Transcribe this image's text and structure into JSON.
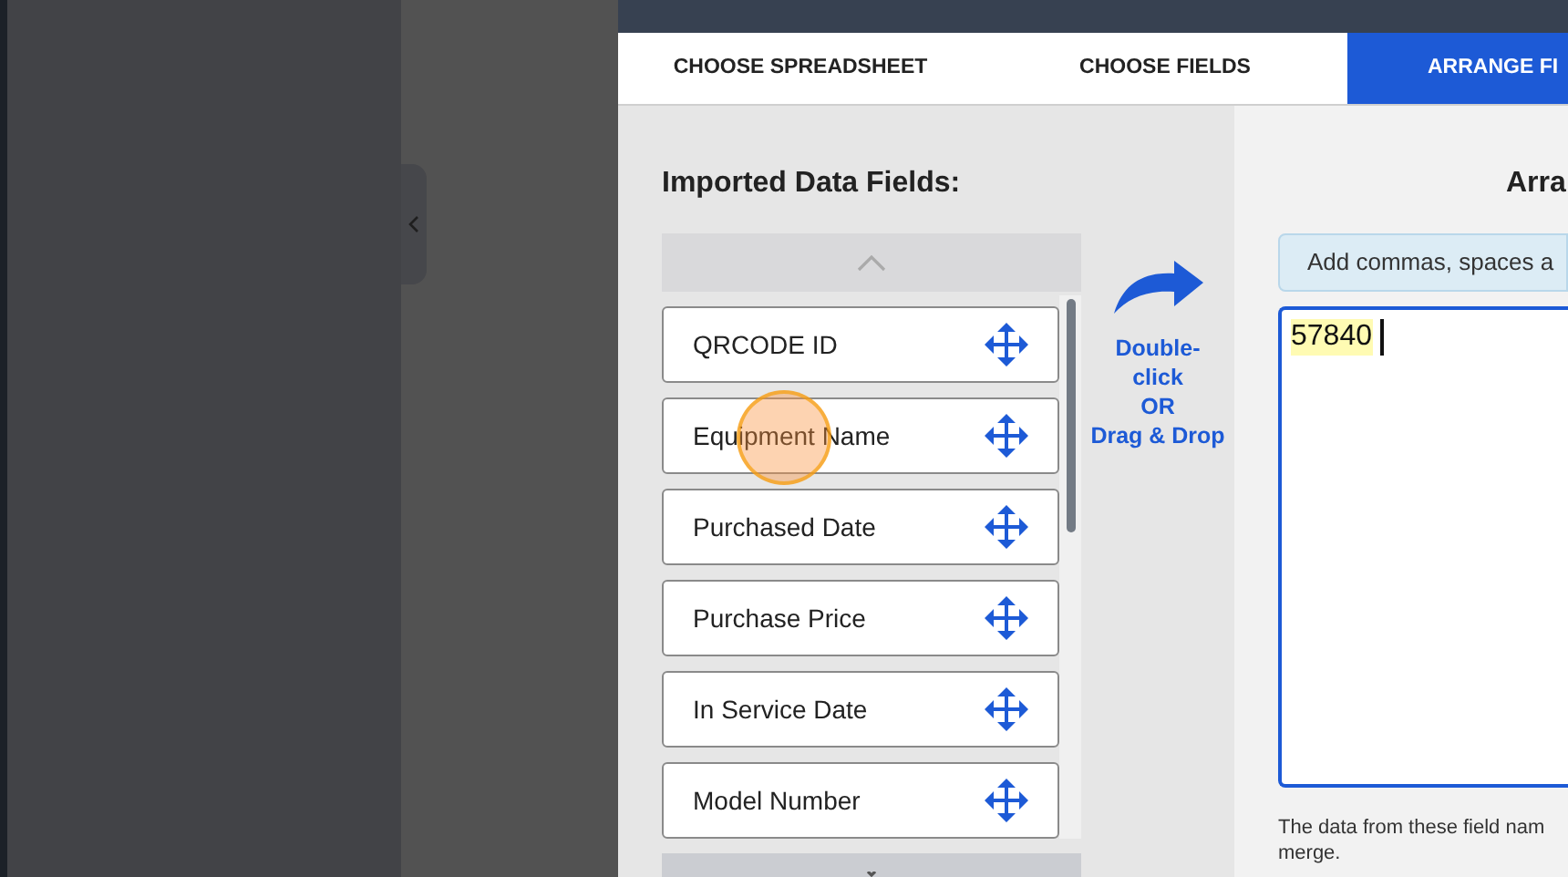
{
  "tabs": [
    {
      "label": "CHOOSE SPREADSHEET",
      "selected": false
    },
    {
      "label": "CHOOSE FIELDS",
      "selected": false
    },
    {
      "label": "ARRANGE FI",
      "selected": true
    }
  ],
  "imported_fields": {
    "title": "Imported Data Fields:",
    "items": [
      "QRCODE ID",
      "Equipment Name",
      "Purchased Date",
      "Purchase Price",
      "In Service Date",
      "Model Number"
    ]
  },
  "hint": "Double-\nclick\nOR\nDrag & Drop",
  "arrange": {
    "title": "Arra",
    "info": "Add commas, spaces a",
    "value": "57840",
    "note": "The data from these field nam\nmerge."
  }
}
